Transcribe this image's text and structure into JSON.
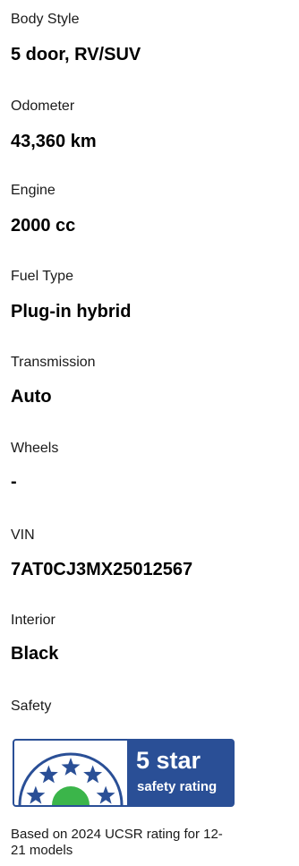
{
  "specs": [
    {
      "label": "Body Style",
      "value": "5 door, RV/SUV"
    },
    {
      "label": "Odometer",
      "value": "43,360 km"
    },
    {
      "label": "Engine",
      "value": "2000 cc"
    },
    {
      "label": "Fuel Type",
      "value": "Plug-in hybrid"
    },
    {
      "label": "Transmission",
      "value": "Auto"
    },
    {
      "label": "Wheels",
      "value": "-"
    },
    {
      "label": "VIN",
      "value": "7AT0CJ3MX25012567"
    },
    {
      "label": "Interior",
      "value": "Black"
    }
  ],
  "safety": {
    "label": "Safety",
    "badge_rating": "5 star",
    "badge_subtitle": "safety rating",
    "stars": 5,
    "note": "Based on 2024 UCSR rating for 12-21 models",
    "colors": {
      "badge_blue": "#2a4f96",
      "star_blue": "#2a4f96",
      "dome_green": "#3bb54a"
    }
  }
}
